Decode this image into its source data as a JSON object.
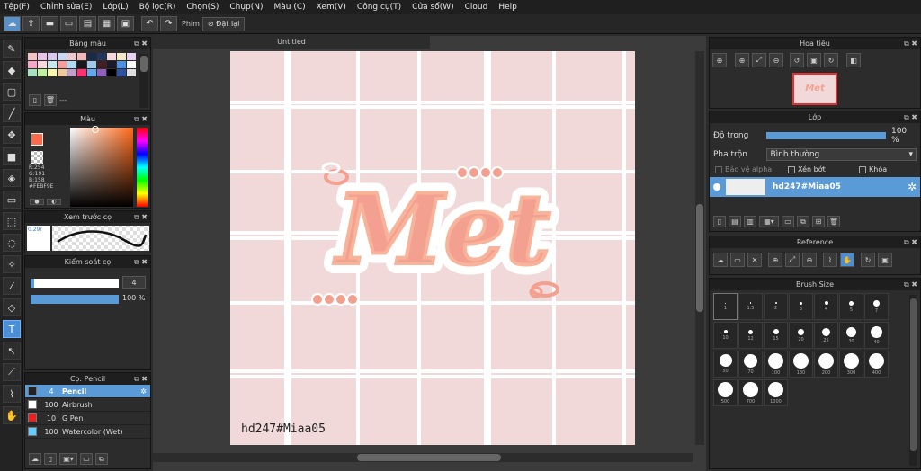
{
  "menu": [
    "Tệp(F)",
    "Chỉnh sửa(E)",
    "Lớp(L)",
    "Bộ lọc(R)",
    "Chọn(S)",
    "Chụp(N)",
    "Màu (C)",
    "Xem(V)",
    "Công cụ(T)",
    "Cửa sổ(W)",
    "Cloud",
    "Help"
  ],
  "toolbar": {
    "keys_label": "Phím",
    "reset_label": "Đặt lại"
  },
  "palette": {
    "title": "Bảng màu",
    "name": "---",
    "colors": [
      "#f4c2c2",
      "#e8c5e8",
      "#d8c8f0",
      "#c8d8f4",
      "#f0c8d0",
      "#f4b8b8",
      "#1a2a4a",
      "#203860",
      "#f7d8d8",
      "#f8e8c8",
      "#e8d0f0",
      "#f4a8c8",
      "#f8d8e0",
      "#c8e8f0",
      "#f0a0a0",
      "#b0d8f0",
      "#181818",
      "#a0c8e8",
      "#402020",
      "#1a1a2a",
      "#5090e0",
      "#ffffff",
      "#a8e0c0",
      "#c0f0a0",
      "#f8f8b0",
      "#f0c8a0",
      "#c0a0c8",
      "#ff3070",
      "#60a8f0",
      "#9060c0",
      "#000000",
      "#3050a0",
      "#e0e0e0"
    ]
  },
  "color": {
    "title": "Màu",
    "r": "R:254",
    "g": "G:191",
    "b": "B:158",
    "hex": "#FEBF9E",
    "fg": "#ff6a4a"
  },
  "brush_preview": {
    "title": "Xem trước cọ",
    "size": "0.29r"
  },
  "brush_control": {
    "title": "Kiểm soát cọ",
    "size": "4",
    "opacity": "100 %"
  },
  "brush_list": {
    "title": "Cọ: Pencil",
    "items": [
      {
        "size": "4",
        "name": "Pencil",
        "color": "#222222",
        "active": true
      },
      {
        "size": "100",
        "name": "Airbrush",
        "color": "#ffffff"
      },
      {
        "size": "10",
        "name": "G Pen",
        "color": "#e82020"
      },
      {
        "size": "100",
        "name": "Watercolor (Wet)",
        "color": "#66ccff"
      }
    ]
  },
  "document": {
    "tab": "Untitled",
    "artwork_text": "Met",
    "watermark": "hd247#Miaa05"
  },
  "navigator": {
    "title": "Hoa tiêu",
    "thumb_text": "Met"
  },
  "layer": {
    "title": "Lớp",
    "opacity_label": "Độ trong",
    "opacity": "100 %",
    "blend_label": "Pha trộn",
    "blend": "Bình thường",
    "protect_alpha": "Bảo vệ alpha",
    "clip": "Xén bớt",
    "lock": "Khóa",
    "layer_name": "hd247#Miaa05"
  },
  "reference": {
    "title": "Reference"
  },
  "brush_size": {
    "title": "Brush Size",
    "sizes": [
      "1",
      "1.5",
      "2",
      "3",
      "4",
      "5",
      "7",
      "10",
      "12",
      "15",
      "20",
      "25",
      "30",
      "40",
      "50",
      "70",
      "100",
      "130",
      "200",
      "300",
      "400",
      "500",
      "700",
      "1000"
    ]
  }
}
